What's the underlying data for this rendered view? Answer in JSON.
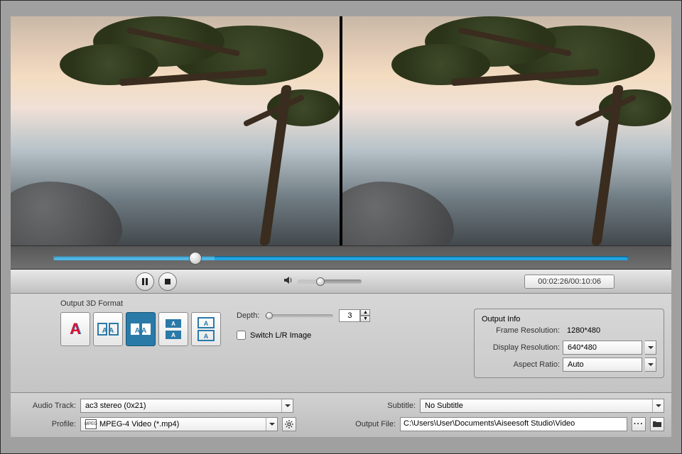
{
  "playback": {
    "time_display": "00:02:26/00:10:06",
    "seek_percent": 28,
    "volume_percent": 35
  },
  "output3d": {
    "panel_title": "Output 3D Format",
    "selected_index": 2,
    "depth_label": "Depth:",
    "depth_value": "3",
    "switch_lr_label": "Switch L/R Image",
    "switch_lr_checked": false
  },
  "output_info": {
    "panel_title": "Output Info",
    "frame_res_label": "Frame Resolution:",
    "frame_res_value": "1280*480",
    "display_res_label": "Display Resolution:",
    "display_res_value": "640*480",
    "aspect_label": "Aspect Ratio:",
    "aspect_value": "Auto"
  },
  "bottom": {
    "audio_label": "Audio Track:",
    "audio_value": "ac3 stereo (0x21)",
    "subtitle_label": "Subtitle:",
    "subtitle_value": "No Subtitle",
    "profile_label": "Profile:",
    "profile_value": "MPEG-4 Video (*.mp4)",
    "output_file_label": "Output File:",
    "output_file_value": "C:\\Users\\User\\Documents\\Aiseesoft Studio\\Video"
  }
}
